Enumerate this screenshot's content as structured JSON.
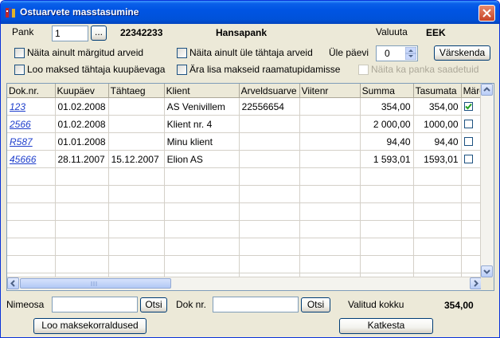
{
  "window": {
    "title": "Ostuarvete masstasumine"
  },
  "header": {
    "bank_label": "Pank",
    "bank_value": "1",
    "browse_label": "...",
    "account_number": "22342233",
    "bank_name": "Hansapank",
    "currency_label": "Valuuta",
    "currency_value": "EEK",
    "overdue_label": "Üle päevi",
    "overdue_value": "0",
    "refresh_label": "Värskenda"
  },
  "options": {
    "only_marked": "Näita ainult märgitud arveid",
    "only_overdue": "Näita ainult üle tähtaja arveid",
    "due_by_date": "Loo maksed tähtaja kuupäevaga",
    "no_accounting": "Ära lisa makseid raamatupidamisse",
    "show_sent": "Näita ka panka saadetuid"
  },
  "table": {
    "columns": [
      "Dok.nr.",
      "Kuupäev",
      "Tähtaeg",
      "Klient",
      "Arveldsuarve",
      "Viitenr",
      "Summa",
      "Tasumata",
      "Märgi"
    ],
    "rows": [
      {
        "doc": "123",
        "date": "01.02.2008",
        "due": "",
        "client": "AS Venivillem",
        "account": "22556654",
        "ref": "",
        "sum": "354,00",
        "unpaid": "354,00",
        "marked": true
      },
      {
        "doc": "2566",
        "date": "01.02.2008",
        "due": "",
        "client": "Klient nr. 4",
        "account": "",
        "ref": "",
        "sum": "2 000,00",
        "unpaid": "1000,00",
        "marked": false
      },
      {
        "doc": "R587",
        "date": "01.01.2008",
        "due": "",
        "client": "Minu klient",
        "account": "",
        "ref": "",
        "sum": "94,40",
        "unpaid": "94,40",
        "marked": false
      },
      {
        "doc": "45666",
        "date": "28.11.2007",
        "due": "15.12.2007",
        "client": "Elion AS",
        "account": "",
        "ref": "",
        "sum": "1 593,01",
        "unpaid": "1593,01",
        "marked": false
      }
    ],
    "empty_rows": 8
  },
  "footer": {
    "name_label": "Nimeosa",
    "name_value": "",
    "search_label": "Otsi",
    "doc_label": "Dok nr.",
    "doc_value": "",
    "selected_label": "Valitud kokku",
    "selected_total": "354,00",
    "create_orders_label": "Loo maksekorraldused",
    "cancel_label": "Katkesta"
  }
}
